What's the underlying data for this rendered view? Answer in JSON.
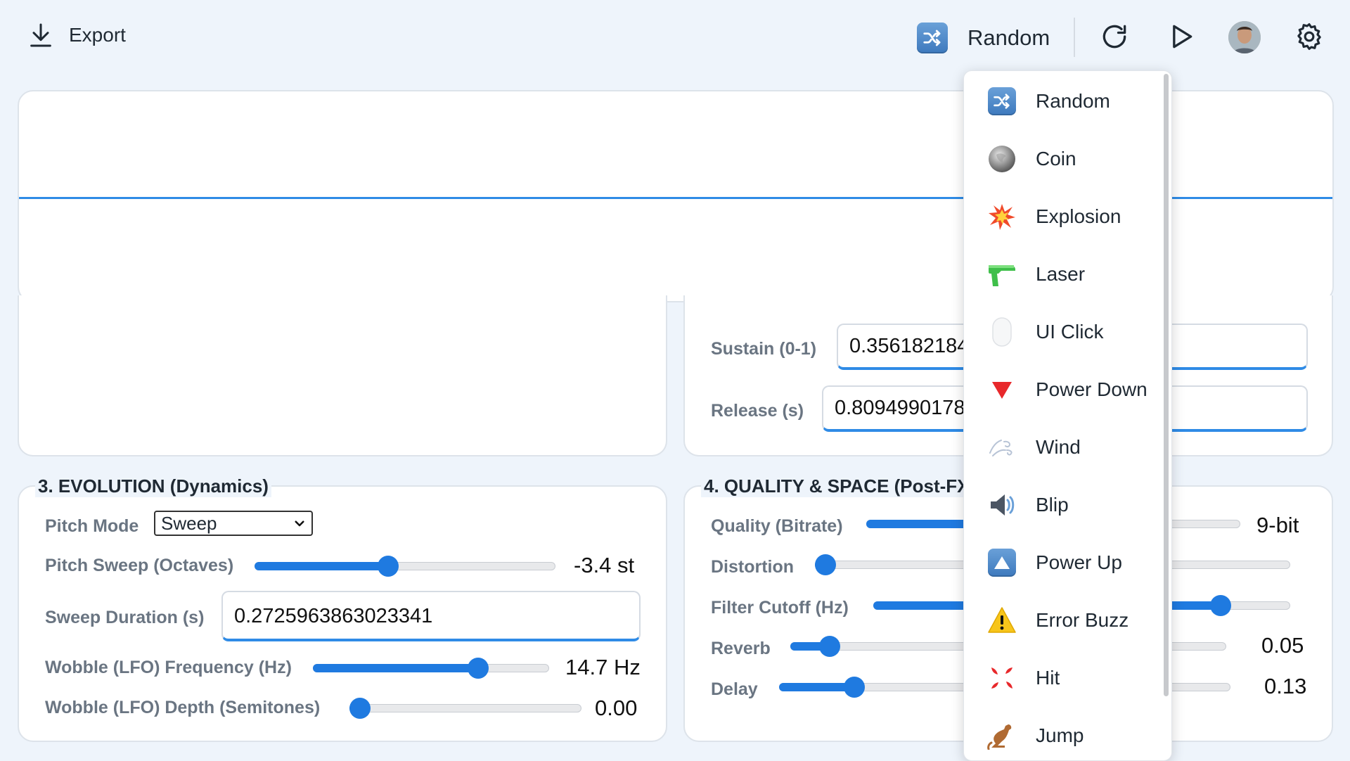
{
  "toolbar": {
    "export_label": "Export",
    "preset_label": "Random",
    "icons": [
      "download-icon",
      "shuffle-icon",
      "reload-icon",
      "play-icon",
      "avatar",
      "gear-icon"
    ]
  },
  "sections": {
    "section2": {
      "sustain_label": "Sustain (0-1)",
      "sustain_value": "0.3561821843",
      "release_label": "Release (s)",
      "release_value": "0.8094990178"
    },
    "section3": {
      "title": "3. EVOLUTION (Dynamics)",
      "pitch_mode_label": "Pitch Mode",
      "pitch_mode_value": "Sweep",
      "pitch_sweep_label": "Pitch Sweep (Octaves)",
      "pitch_sweep_value": "-3.4 st",
      "pitch_sweep_level": 0.44,
      "sweep_duration_label": "Sweep Duration (s)",
      "sweep_duration_value": "0.2725963863023341",
      "lfo_freq_label": "Wobble (LFO) Frequency (Hz)",
      "lfo_freq_value": "14.7 Hz",
      "lfo_freq_level": 0.72,
      "lfo_depth_label": "Wobble (LFO) Depth (Semitones)",
      "lfo_depth_value": "0.00",
      "lfo_depth_level": 0.0
    },
    "section4": {
      "title": "4. QUALITY & SPACE (Post-FX)",
      "quality_label": "Quality (Bitrate)",
      "quality_value": "9-bit",
      "quality_level": 0.6,
      "distortion_label": "Distortion",
      "distortion_level": 0.0,
      "filter_label": "Filter Cutoff (Hz)",
      "filter_level": 0.85,
      "reverb_label": "Reverb",
      "reverb_value": "0.05",
      "reverb_level": 0.07,
      "delay_label": "Delay",
      "delay_value": "0.13",
      "delay_level": 0.15
    }
  },
  "menu": {
    "items": [
      {
        "label": "Random",
        "icon": "shuffle-icon"
      },
      {
        "label": "Coin",
        "icon": "coin-icon"
      },
      {
        "label": "Explosion",
        "icon": "explosion-icon"
      },
      {
        "label": "Laser",
        "icon": "laser-gun-icon"
      },
      {
        "label": "UI Click",
        "icon": "mouse-icon"
      },
      {
        "label": "Power Down",
        "icon": "triangle-down-icon"
      },
      {
        "label": "Wind",
        "icon": "wind-icon"
      },
      {
        "label": "Blip",
        "icon": "speaker-icon"
      },
      {
        "label": "Power Up",
        "icon": "triangle-up-icon"
      },
      {
        "label": "Error Buzz",
        "icon": "warning-icon"
      },
      {
        "label": "Hit",
        "icon": "anger-icon"
      },
      {
        "label": "Jump",
        "icon": "kangaroo-icon"
      }
    ]
  },
  "colors": {
    "accent": "#1f7ae0",
    "waveform": "#2f8be6",
    "background": "#eef4fb"
  }
}
